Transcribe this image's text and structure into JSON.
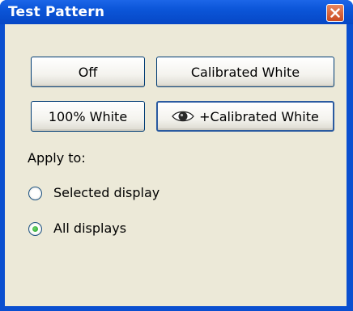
{
  "window": {
    "title": "Test Pattern"
  },
  "buttons": {
    "off": "Off",
    "calibrated_white": "Calibrated White",
    "white_100": "100% White",
    "plus_calibrated_white": "+Calibrated White"
  },
  "apply_to": {
    "label": "Apply to:",
    "options": [
      {
        "label": "Selected display",
        "selected": false
      },
      {
        "label": "All displays",
        "selected": true
      }
    ]
  },
  "icons": {
    "close": "close-icon",
    "eye": "eye-icon"
  },
  "colors": {
    "titlebar": "#0b55d8",
    "client": "#ece9d8",
    "close": "#d85a2c",
    "radio_dot": "#21a121"
  }
}
